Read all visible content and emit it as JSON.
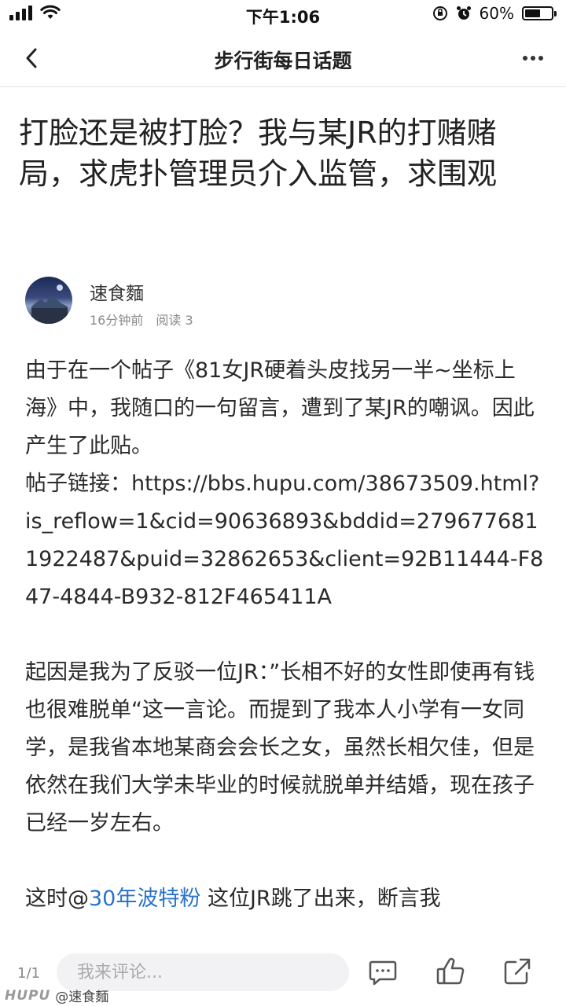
{
  "status_bar": {
    "time": "下午1:06",
    "battery": "60%",
    "battery_level": 0.6
  },
  "nav": {
    "title": "步行街每日话题"
  },
  "post": {
    "title": "打脸还是被打脸？我与某JR的打赌赌局，求虎扑管理员介入监管，求围观",
    "author": "速食麵",
    "time_ago": "16分钟前",
    "reads": "阅读 3",
    "para1": "由于在一个帖子《81女JR硬着头皮找另一半~坐标上海》中，我随口的一句留言，遭到了某JR的嘲讽。因此产生了此贴。",
    "link_prefix": "帖子链接：",
    "link_url": "https://bbs.hupu.com/38673509.html?is_reflow=1&cid=90636893&bddid=2796776811922487&puid=32862653&client=92B11444-F847-4844-B932-812F465411A",
    "para2": "起因是我为了反驳一位JR：”长相不好的女性即使再有钱也很难脱单“这一言论。而提到了我本人小学有一女同学，是我省本地某商会会长之女，虽然长相欠佳，但是依然在我们大学未毕业的时候就脱单并结婚，现在孩子已经一岁左右。",
    "para3_before": "这时@",
    "para3_mention": "30年波特粉",
    "para3_after": " 这位JR跳了出来，断言我"
  },
  "bottom_bar": {
    "page_count": "1/1",
    "comment_placeholder": "我来评论..."
  },
  "watermark": {
    "logo": "HUPU",
    "user": "@速食麵"
  },
  "icons": {
    "back": "chevron-left-icon",
    "more": "more-dots-icon",
    "comment": "comment-bubble-icon",
    "like": "thumbs-up-icon",
    "share": "share-icon"
  },
  "colors": {
    "mention": "#2a73c9",
    "meta_text": "#8a8a8a",
    "input_bg": "#f2f2f4"
  }
}
